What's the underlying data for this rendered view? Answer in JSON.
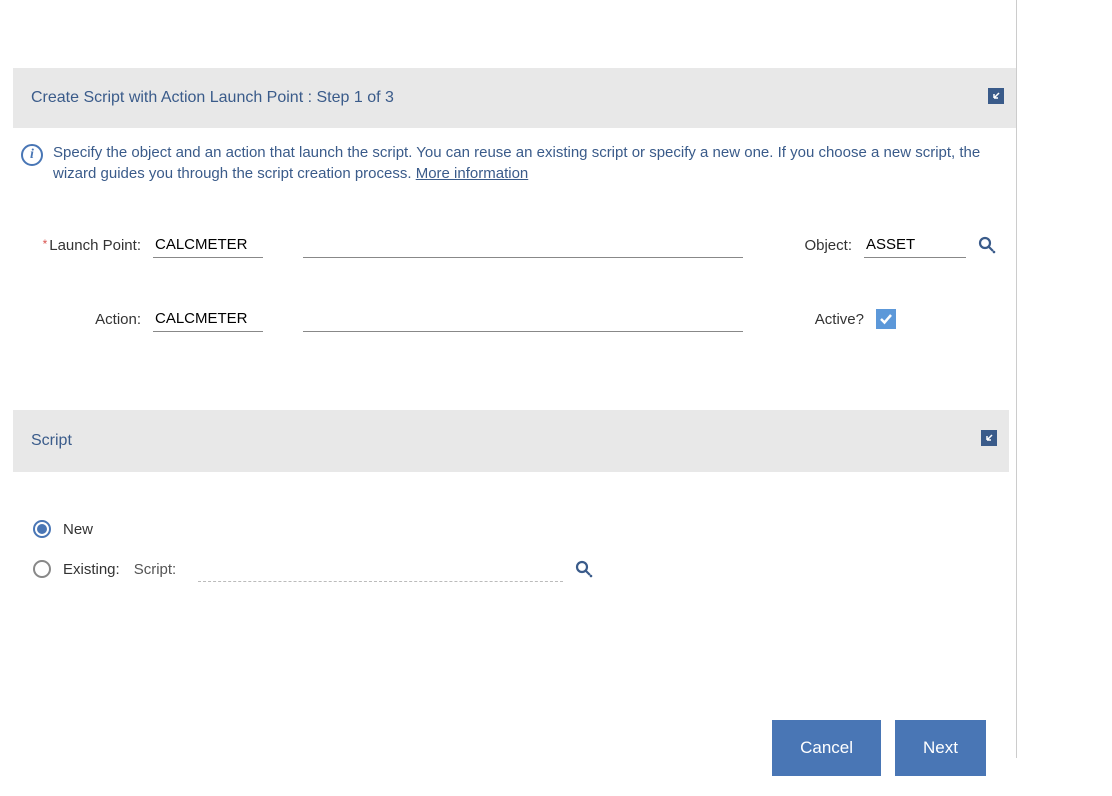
{
  "header": {
    "title": "Create Script with Action Launch Point : Step 1 of 3"
  },
  "info": {
    "text_part1": "Specify the object and an action that launch the script. You can reuse an existing script or specify a new one. If you choose a new script, the wizard guides you through the script creation process. ",
    "link_text": "More information"
  },
  "form": {
    "launch_point": {
      "label": "Launch Point:",
      "value": "CALCMETER",
      "desc": ""
    },
    "object": {
      "label": "Object:",
      "value": "ASSET"
    },
    "action": {
      "label": "Action:",
      "value": "CALCMETER",
      "desc": ""
    },
    "active": {
      "label": "Active?",
      "checked": true
    }
  },
  "script_section": {
    "title": "Script",
    "new_label": "New",
    "existing_label": "Existing:",
    "script_label": "Script:",
    "script_value": "",
    "selected": "new"
  },
  "buttons": {
    "cancel": "Cancel",
    "next": "Next"
  }
}
